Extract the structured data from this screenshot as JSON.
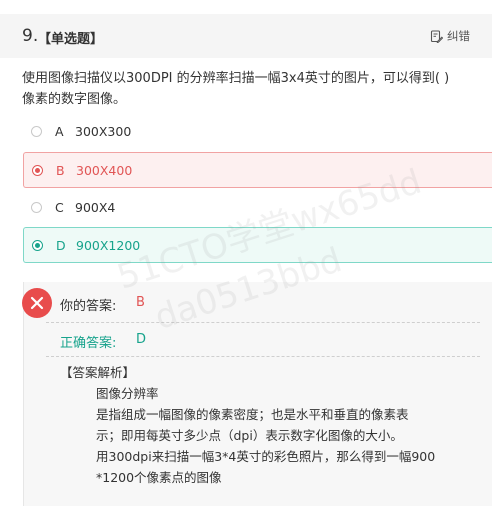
{
  "question": {
    "number": "9.",
    "type_label": "【单选题】",
    "report_label": "纠错",
    "stem_lines": [
      "使用图像扫描仪以300DPI 的分辨率扫描一幅3x4英寸的图片，可以得到( )",
      "像素的数字图像。"
    ]
  },
  "options": [
    {
      "letter": "A",
      "text": "300X300",
      "state": "normal"
    },
    {
      "letter": "B",
      "text": "300X400",
      "state": "wrong-selected"
    },
    {
      "letter": "C",
      "text": "900X4",
      "state": "normal"
    },
    {
      "letter": "D",
      "text": "900X1200",
      "state": "correct"
    }
  ],
  "result": {
    "your_answer_label": "你的答案:",
    "your_answer_value": "B",
    "correct_answer_label": "正确答案:",
    "correct_answer_value": "D",
    "analysis_title": "【答案解析】",
    "analysis_lines": [
      "图像分辨率",
      "是指组成一幅图像的像素密度；也是水平和垂直的像素表",
      "示；即用每英寸多少点（dpi）表示数字化图像的大小。",
      "用300dpi来扫描一幅3*4英寸的彩色照片，那么得到一幅900",
      "*1200个像素点的图像"
    ]
  },
  "watermark": {
    "line1": "51CTO学堂wx65dd",
    "line2": "da0513bbd"
  },
  "colors": {
    "wrong": "#e15555",
    "correct": "#17a38c",
    "header_bg": "#f5f5f5"
  }
}
